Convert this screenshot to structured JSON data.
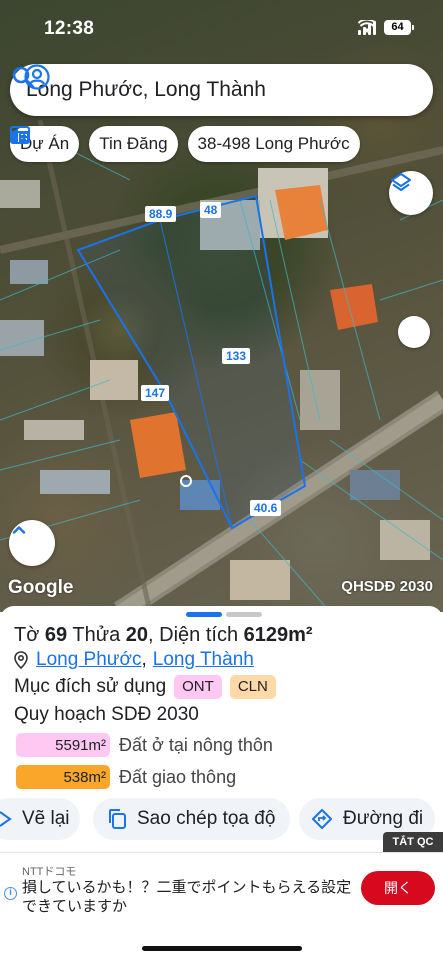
{
  "status_bar": {
    "time": "12:38",
    "battery": "64"
  },
  "search": {
    "query": "Long Phước, Long Thành"
  },
  "chips": {
    "project": "Dự Án",
    "listings": "Tin Đăng",
    "address": "38-498 Long Phước"
  },
  "map": {
    "google_label": "Google",
    "layer_label": "QHSDĐ 2030",
    "dimensions": [
      "88.9",
      "48",
      "133",
      "147",
      "40.6"
    ],
    "boundary_color": "#1a73e8"
  },
  "parcel": {
    "sheet_prefix": "Tờ",
    "sheet_number": "69",
    "lot_prefix": "Thửa",
    "lot_number": "20",
    "area_prefix": ", Diện tích",
    "area_value": "6129m²",
    "ward_link": "Long Phước",
    "district_link": "Long Thành",
    "separator": ",",
    "purpose_label": "Mục đích sử dụng",
    "tags": [
      "ONT",
      "CLN"
    ],
    "plan_label": "Quy hoạch SDĐ 2030",
    "areas": [
      {
        "value": "5591m²",
        "label": "Đất ở tại nông thôn",
        "color": "#ffc8f2"
      },
      {
        "value": "538m²",
        "label": "Đất giao thông",
        "color": "#f9a62a"
      }
    ]
  },
  "actions": {
    "redraw": "Vẽ lại",
    "copy_coords": "Sao chép tọa độ",
    "directions": "Đường đi"
  },
  "ad": {
    "close_label": "TẮT QC",
    "brand": "NTTドコモ",
    "text": "損しているかも！？二重でポイントもらえる設定できていますか",
    "cta": "開く"
  }
}
